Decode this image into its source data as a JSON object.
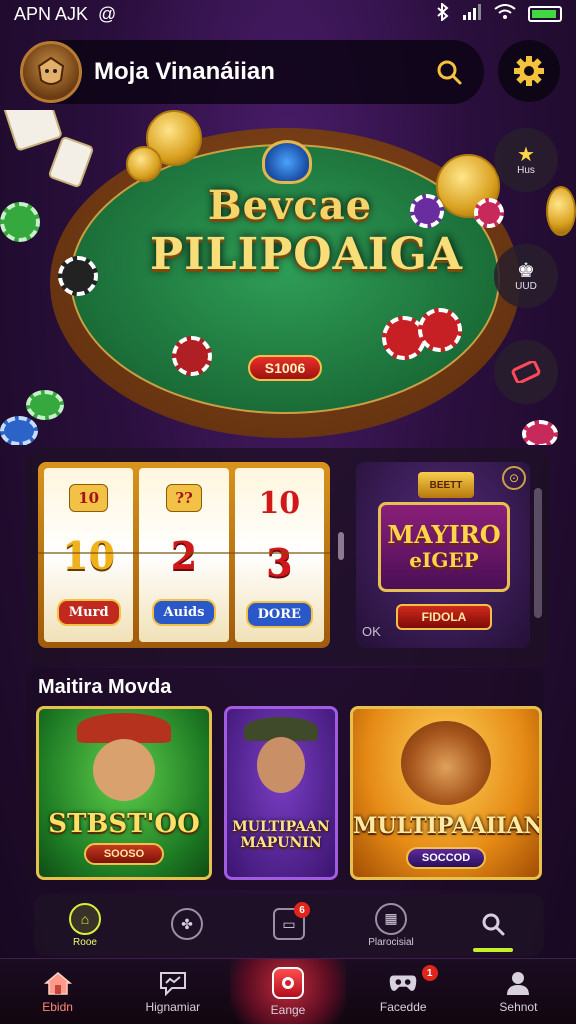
{
  "status_bar": {
    "carrier": "APN AJK",
    "at_icon": "@",
    "icons": [
      "bluetooth-icon",
      "signal-icon",
      "wifi-icon",
      "battery-icon"
    ]
  },
  "header": {
    "user_name": "Moja Vinanáiian",
    "avatar_icon": "avatar-icon",
    "search_icon": "search-icon",
    "settings_icon": "gear-icon"
  },
  "hero": {
    "title_line1": "Bevcae",
    "title_line2": "PILIPOAIGA",
    "bet_label": "S1006"
  },
  "side_buttons": [
    {
      "label": "Hus",
      "icon": "trophy-icon"
    },
    {
      "label": "UUD",
      "icon": "crown-icon"
    },
    {
      "label": "",
      "icon": "ticket-icon"
    }
  ],
  "slot_machine": {
    "reels": [
      {
        "top": "10",
        "mid": "10",
        "bot": "Murd"
      },
      {
        "top": "??",
        "mid": "2",
        "bot": "Auids"
      },
      {
        "top": "10",
        "mid": "3",
        "bot": "DORE"
      }
    ]
  },
  "promo": {
    "badge": "BEETT",
    "title": "MAYIRO",
    "subtitle": "eIGEP",
    "button": "FIDOLA",
    "ok": "OK"
  },
  "section": {
    "title": "Maitira Movda"
  },
  "games": [
    {
      "title": "STBST'OO",
      "button": "SOOSO"
    },
    {
      "title": "MULTIPAAN MAPUNIN",
      "button": ""
    },
    {
      "title": "MULTIPAAIIAN",
      "button": "SOCCOD"
    }
  ],
  "sub_nav": [
    {
      "label": "Rooe",
      "icon": "home-icon",
      "active": true,
      "badge": ""
    },
    {
      "label": "",
      "icon": "controller-icon",
      "active": false,
      "badge": ""
    },
    {
      "label": "",
      "icon": "chat-icon",
      "active": false,
      "badge": "6"
    },
    {
      "label": "Plarocisial",
      "icon": "calendar-icon",
      "active": false,
      "badge": ""
    },
    {
      "label": "",
      "icon": "search-icon",
      "active": false,
      "badge": ""
    }
  ],
  "tab_bar": [
    {
      "label": "Ebidn",
      "icon": "home-icon",
      "active": true,
      "badge": ""
    },
    {
      "label": "Hignamiar",
      "icon": "chat-bubble-icon",
      "active": false,
      "badge": ""
    },
    {
      "label": "Eange",
      "icon": "play-icon",
      "active": false,
      "badge": "",
      "center": true
    },
    {
      "label": "Facedde",
      "icon": "gamepad-icon",
      "active": false,
      "badge": "1"
    },
    {
      "label": "Sehnot",
      "icon": "user-icon",
      "active": false,
      "badge": ""
    }
  ],
  "colors": {
    "accent": "#d7f03a",
    "gold": "#f2c048",
    "background": "#2a0f3d"
  }
}
